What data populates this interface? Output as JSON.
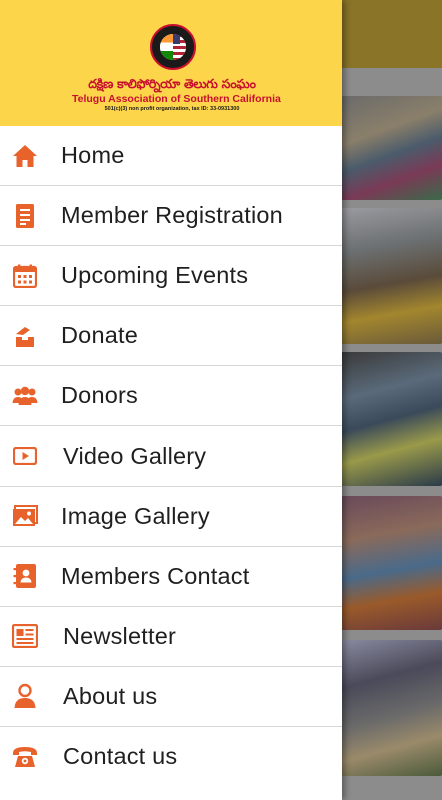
{
  "colors": {
    "accent": "#e8622c",
    "header_bg": "#fdd54a",
    "logo_red": "#c8102e"
  },
  "header": {
    "logo": {
      "telugu_name": "దక్షిణ కాలిఫోర్నియా తెలుగు సంఘం",
      "english_name": "Telugu Association of Southern California",
      "subtitle": "501(c)(3) non profit organization, tax ID: 33-0931300"
    }
  },
  "menu": [
    {
      "label": "Home",
      "icon": "home-icon"
    },
    {
      "label": "Member Registration",
      "icon": "registration-form-icon"
    },
    {
      "label": "Upcoming Events",
      "icon": "calendar-icon"
    },
    {
      "label": "Donate",
      "icon": "donate-hand-icon"
    },
    {
      "label": "Donors",
      "icon": "people-group-icon"
    },
    {
      "label": "Video Gallery",
      "icon": "video-play-icon"
    },
    {
      "label": "Image Gallery",
      "icon": "image-gallery-icon"
    },
    {
      "label": "Members Contact",
      "icon": "contact-book-icon"
    },
    {
      "label": "Newsletter",
      "icon": "newspaper-icon"
    },
    {
      "label": "About us",
      "icon": "person-icon"
    },
    {
      "label": "Contact us",
      "icon": "telephone-icon"
    }
  ]
}
